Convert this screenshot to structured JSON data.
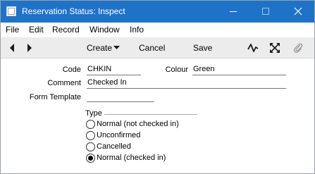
{
  "window": {
    "title": "Reservation Status: Inspect"
  },
  "menu": [
    "File",
    "Edit",
    "Record",
    "Window",
    "Info"
  ],
  "toolbar": {
    "create_label": "Create",
    "cancel_label": "Cancel",
    "save_label": "Save"
  },
  "form": {
    "code_label": "Code",
    "code_value": "CHKIN",
    "colour_label": "Colour",
    "colour_value": "Green",
    "comment_label": "Comment",
    "comment_value": "Checked In",
    "form_template_label": "Form Template",
    "form_template_value": "",
    "type_group_label": "Type",
    "type_options": [
      {
        "label": "Normal (not checked in)",
        "selected": false
      },
      {
        "label": "Unconfirmed",
        "selected": false
      },
      {
        "label": "Cancelled",
        "selected": false
      },
      {
        "label": "Normal (checked in)",
        "selected": true
      }
    ]
  },
  "colors": {
    "titlebar": "#1e73c8",
    "toolbar": "#ececec"
  },
  "icons": [
    "app-icon",
    "minimize-icon",
    "maximize-icon",
    "close-icon",
    "back-arrow-icon",
    "forward-arrow-icon",
    "chevron-down-icon",
    "activity-icon",
    "expand-icon",
    "paperclip-icon"
  ]
}
